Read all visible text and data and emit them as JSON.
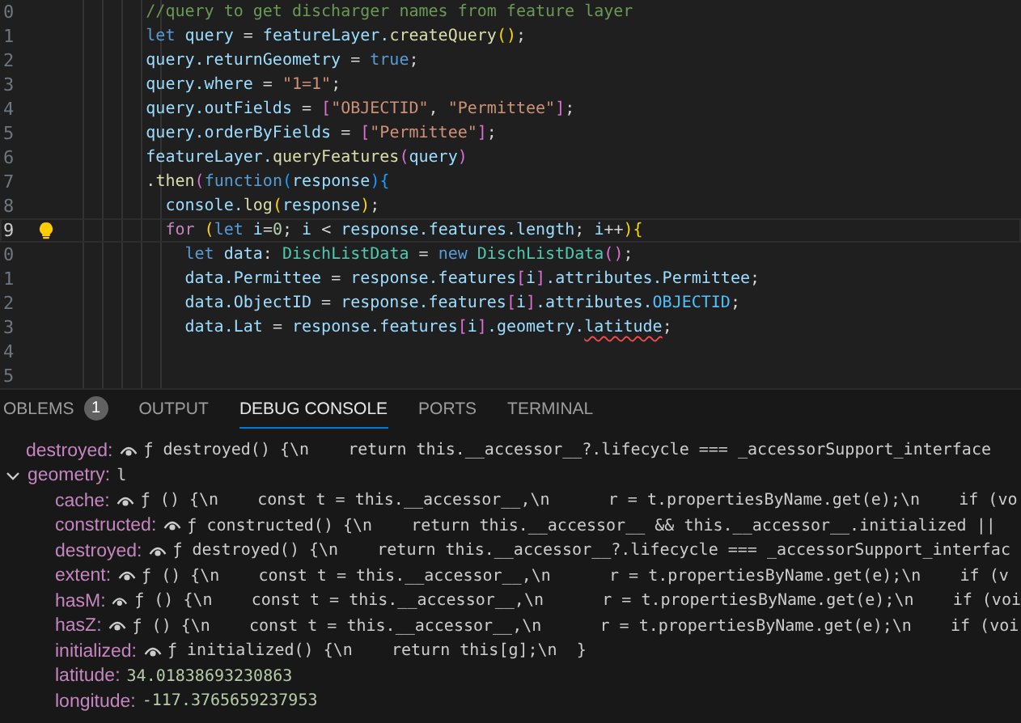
{
  "editor": {
    "lines": [
      {
        "number": "0",
        "current": false,
        "tokens": [
          {
            "text": "        //query to get discharger names from feature layer",
            "kind": "comment"
          }
        ]
      },
      {
        "number": "1",
        "current": false,
        "tokens": [
          {
            "text": "        let",
            "kind": "keyword"
          },
          {
            "text": " query",
            "kind": "variable"
          },
          {
            "text": " = ",
            "kind": "plain"
          },
          {
            "text": "featureLayer.",
            "kind": "variable"
          },
          {
            "text": "createQuery",
            "kind": "function"
          },
          {
            "text": "()",
            "kind": "bracket1"
          },
          {
            "text": ";",
            "kind": "plain"
          }
        ]
      },
      {
        "number": "2",
        "current": false,
        "tokens": [
          {
            "text": "        query.returnGeometry",
            "kind": "variable"
          },
          {
            "text": " = ",
            "kind": "plain"
          },
          {
            "text": "true",
            "kind": "keyword"
          },
          {
            "text": ";",
            "kind": "plain"
          }
        ]
      },
      {
        "number": "3",
        "current": false,
        "tokens": [
          {
            "text": "        query.where",
            "kind": "variable"
          },
          {
            "text": " = ",
            "kind": "plain"
          },
          {
            "text": "\"1=1\"",
            "kind": "string"
          },
          {
            "text": ";",
            "kind": "plain"
          }
        ]
      },
      {
        "number": "4",
        "current": false,
        "tokens": [
          {
            "text": "        query.outFields",
            "kind": "variable"
          },
          {
            "text": " = ",
            "kind": "plain"
          },
          {
            "text": "[",
            "kind": "bracket2"
          },
          {
            "text": "\"OBJECTID\"",
            "kind": "string"
          },
          {
            "text": ", ",
            "kind": "plain"
          },
          {
            "text": "\"Permittee\"",
            "kind": "string"
          },
          {
            "text": "]",
            "kind": "bracket2"
          },
          {
            "text": ";",
            "kind": "plain"
          }
        ]
      },
      {
        "number": "5",
        "current": false,
        "tokens": [
          {
            "text": "        query.orderByFields",
            "kind": "variable"
          },
          {
            "text": " = ",
            "kind": "plain"
          },
          {
            "text": "[",
            "kind": "bracket2"
          },
          {
            "text": "\"Permittee\"",
            "kind": "string"
          },
          {
            "text": "]",
            "kind": "bracket2"
          },
          {
            "text": ";",
            "kind": "plain"
          }
        ]
      },
      {
        "number": "6",
        "current": false,
        "tokens": [
          {
            "text": "        featureLayer.",
            "kind": "variable"
          },
          {
            "text": "queryFeatures",
            "kind": "function"
          },
          {
            "text": "(",
            "kind": "bracket2"
          },
          {
            "text": "query",
            "kind": "variable"
          },
          {
            "text": ")",
            "kind": "bracket2"
          }
        ]
      },
      {
        "number": "7",
        "current": false,
        "tokens": [
          {
            "text": "        .",
            "kind": "plain"
          },
          {
            "text": "then",
            "kind": "function"
          },
          {
            "text": "(",
            "kind": "bracket2"
          },
          {
            "text": "function",
            "kind": "keyword"
          },
          {
            "text": "(",
            "kind": "bracket3"
          },
          {
            "text": "response",
            "kind": "variable"
          },
          {
            "text": "){",
            "kind": "bracket3"
          }
        ]
      },
      {
        "number": "8",
        "current": false,
        "tokens": [
          {
            "text": "          console.",
            "kind": "variable"
          },
          {
            "text": "log",
            "kind": "function"
          },
          {
            "text": "(",
            "kind": "bracket1"
          },
          {
            "text": "response",
            "kind": "variable"
          },
          {
            "text": ")",
            "kind": "bracket1"
          },
          {
            "text": ";",
            "kind": "plain"
          }
        ]
      },
      {
        "number": "9",
        "current": true,
        "tokens": [
          {
            "text": "          for",
            "kind": "control"
          },
          {
            "text": " (",
            "kind": "bracket1"
          },
          {
            "text": "let",
            "kind": "keyword"
          },
          {
            "text": " i",
            "kind": "variable"
          },
          {
            "text": "=",
            "kind": "plain"
          },
          {
            "text": "0",
            "kind": "number"
          },
          {
            "text": "; ",
            "kind": "plain"
          },
          {
            "text": "i",
            "kind": "variable"
          },
          {
            "text": " < ",
            "kind": "plain"
          },
          {
            "text": "response.features.length",
            "kind": "variable"
          },
          {
            "text": "; ",
            "kind": "plain"
          },
          {
            "text": "i",
            "kind": "variable"
          },
          {
            "text": "++",
            "kind": "plain"
          },
          {
            "text": "){",
            "kind": "bracket1"
          }
        ]
      },
      {
        "number": "0",
        "current": false,
        "tokens": [
          {
            "text": "            let",
            "kind": "keyword"
          },
          {
            "text": " data",
            "kind": "variable"
          },
          {
            "text": ": ",
            "kind": "plain"
          },
          {
            "text": "DischListData",
            "kind": "type"
          },
          {
            "text": " = ",
            "kind": "plain"
          },
          {
            "text": "new",
            "kind": "keyword"
          },
          {
            "text": " DischListData",
            "kind": "type"
          },
          {
            "text": "()",
            "kind": "bracket2"
          },
          {
            "text": ";",
            "kind": "plain"
          }
        ]
      },
      {
        "number": "1",
        "current": false,
        "tokens": [
          {
            "text": "            data.Permittee",
            "kind": "variable"
          },
          {
            "text": " = ",
            "kind": "plain"
          },
          {
            "text": "response.features",
            "kind": "variable"
          },
          {
            "text": "[",
            "kind": "bracket2"
          },
          {
            "text": "i",
            "kind": "variable"
          },
          {
            "text": "]",
            "kind": "bracket2"
          },
          {
            "text": ".attributes.Permittee",
            "kind": "variable"
          },
          {
            "text": ";",
            "kind": "plain"
          }
        ]
      },
      {
        "number": "2",
        "current": false,
        "tokens": [
          {
            "text": "            data.ObjectID",
            "kind": "variable"
          },
          {
            "text": " = ",
            "kind": "plain"
          },
          {
            "text": "response.features",
            "kind": "variable"
          },
          {
            "text": "[",
            "kind": "bracket2"
          },
          {
            "text": "i",
            "kind": "variable"
          },
          {
            "text": "]",
            "kind": "bracket2"
          },
          {
            "text": ".attributes.",
            "kind": "variable"
          },
          {
            "text": "OBJECTID",
            "kind": "constant"
          },
          {
            "text": ";",
            "kind": "plain"
          }
        ]
      },
      {
        "number": "3",
        "current": false,
        "tokens": [
          {
            "text": "            data.Lat",
            "kind": "variable"
          },
          {
            "text": " = ",
            "kind": "plain"
          },
          {
            "text": "response.features",
            "kind": "variable"
          },
          {
            "text": "[",
            "kind": "bracket2"
          },
          {
            "text": "i",
            "kind": "variable"
          },
          {
            "text": "]",
            "kind": "bracket2"
          },
          {
            "text": ".geometry.",
            "kind": "variable"
          },
          {
            "text": "latitude",
            "kind": "error"
          },
          {
            "text": ";",
            "kind": "plain"
          }
        ]
      },
      {
        "number": "4",
        "current": false
      },
      {
        "number": "5",
        "current": false
      }
    ]
  },
  "panel": {
    "tabs": [
      {
        "label": "OBLEMS",
        "badge": "1",
        "selected": false
      },
      {
        "label": "OUTPUT",
        "selected": false
      },
      {
        "label": "DEBUG CONSOLE",
        "selected": true
      },
      {
        "label": "PORTS",
        "selected": false
      },
      {
        "label": "TERMINAL",
        "selected": false
      }
    ]
  },
  "console": {
    "rows": [
      {
        "key": "destroyed:",
        "getter": true,
        "value": "ƒ destroyed() {\\n    return this.__accessor__?.lifecycle === _accessorSupport_interface",
        "kind": "text"
      },
      {
        "key": "geometry:",
        "getter": false,
        "value": "l",
        "kind": "text",
        "expanded": true,
        "children": [
          {
            "key": "cache:",
            "getter": true,
            "value": "ƒ () {\\n    const t = this.__accessor__,\\n      r = t.propertiesByName.get(e);\\n    if (vo",
            "kind": "text"
          },
          {
            "key": "constructed:",
            "getter": true,
            "value": "ƒ constructed() {\\n    return this.__accessor__ && this.__accessor__.initialized ||",
            "kind": "text"
          },
          {
            "key": "destroyed:",
            "getter": true,
            "value": "ƒ destroyed() {\\n    return this.__accessor__?.lifecycle === _accessorSupport_interfac",
            "kind": "text"
          },
          {
            "key": "extent:",
            "getter": true,
            "value": "ƒ () {\\n    const t = this.__accessor__,\\n      r = t.propertiesByName.get(e);\\n    if (v",
            "kind": "text"
          },
          {
            "key": "hasM:",
            "getter": true,
            "value": "ƒ () {\\n    const t = this.__accessor__,\\n      r = t.propertiesByName.get(e);\\n    if (voi",
            "kind": "text"
          },
          {
            "key": "hasZ:",
            "getter": true,
            "value": "ƒ () {\\n    const t = this.__accessor__,\\n      r = t.propertiesByName.get(e);\\n    if (voi",
            "kind": "text"
          },
          {
            "key": "initialized:",
            "getter": true,
            "value": "ƒ initialized() {\\n    return this[g];\\n  }",
            "kind": "text"
          },
          {
            "key": "latitude:",
            "getter": false,
            "value": "34.01838693230863",
            "kind": "number"
          },
          {
            "key": "longitude:",
            "getter": false,
            "value": "-117.3765659237953",
            "kind": "number"
          }
        ]
      }
    ]
  }
}
